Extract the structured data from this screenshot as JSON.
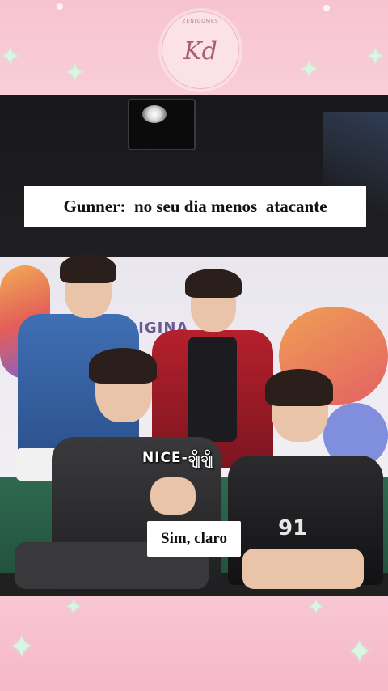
{
  "watermark": {
    "ring_text": "ZENIGOMES",
    "monogram": "Kd",
    "bottom_text": ""
  },
  "overlay_tag": "NICE-ချိုချို",
  "captions": {
    "top": "Gunner:  no seu dia menos  atacante",
    "bottom": "Sim, claro"
  },
  "backdrop_brand": "ORIGINA",
  "jersey_number": "91",
  "colors": {
    "frame_pink": "#f7c3d2",
    "sparkle_green": "#d8f6e2",
    "caption_bg": "#ffffff",
    "caption_text": "#111111"
  },
  "icons": [
    "sparkle-icon",
    "sparkle-icon",
    "sparkle-icon",
    "sparkle-icon"
  ]
}
